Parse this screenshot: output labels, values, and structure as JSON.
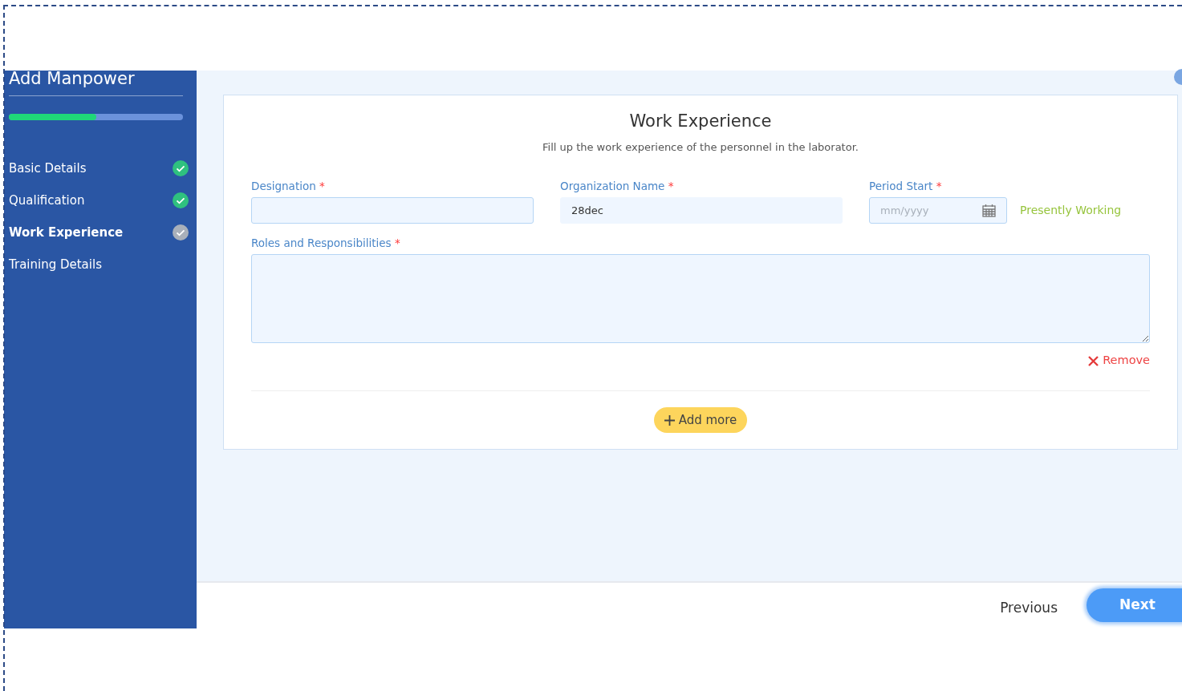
{
  "sidebar": {
    "title": "Add Manpower",
    "progress": {
      "level": 0.5
    },
    "steps": [
      {
        "label": "Basic Details",
        "kind": "done",
        "selected": false
      },
      {
        "label": "Qualification",
        "kind": "done",
        "selected": false
      },
      {
        "label": "Work Experience",
        "kind": "current",
        "selected": true
      },
      {
        "label": "Training Details",
        "kind": "todo",
        "selected": false
      }
    ]
  },
  "form": {
    "title": "Work Experience",
    "subtitle": "Fill up the work experience of the personnel in the laborator.",
    "fields": [
      {
        "kind": "text",
        "label": "Designation",
        "required": "*"
      },
      {
        "kind": "text",
        "label": "Organization Name",
        "required": "*",
        "value": "28dec"
      },
      {
        "kind": "date",
        "label": "Period Start",
        "required": "*",
        "placeholder": "mm/yyyy",
        "extra": "Presently Working"
      },
      {
        "kind": "textarea",
        "label": "Roles and Responsibilities",
        "required": "*"
      }
    ],
    "remove": "Remove",
    "add_more": "Add more"
  },
  "footer": {
    "previous": "Previous",
    "next": "Next"
  }
}
